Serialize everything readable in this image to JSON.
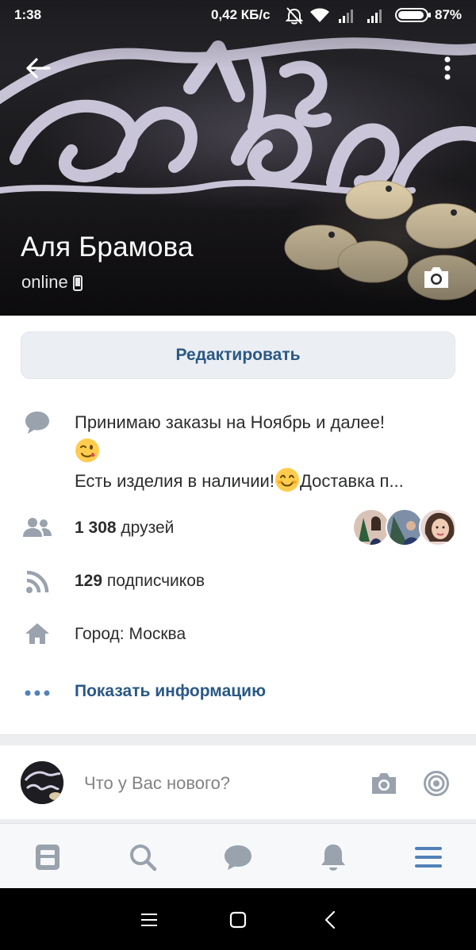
{
  "status_bar": {
    "time": "1:38",
    "network_speed": "0,42 КБ/с",
    "battery_percent": "87%",
    "icons": [
      "alarm-off-icon",
      "wifi-icon",
      "signal-icon",
      "signal-icon",
      "battery-icon"
    ]
  },
  "header": {
    "back_icon": "arrow-left-icon",
    "more_icon": "more-vertical-icon",
    "name": "Аля Брамова",
    "presence": "online",
    "presence_icon": "mobile-phone-icon",
    "cover_camera_icon": "camera-icon"
  },
  "edit_button": {
    "label": "Редактировать"
  },
  "status": {
    "icon": "speech-bubble-icon",
    "line1": "Принимаю заказы на Ноябрь и далее!",
    "line2_emoji": "winking-face-emoji",
    "line3_before_emoji": "Есть изделия в наличии!",
    "line3_emoji": "smiling-face-emoji",
    "line3_after_emoji": "Доставка п..."
  },
  "friends": {
    "icon": "people-icon",
    "count": "1 308",
    "label": "друзей",
    "avatars_count": 3
  },
  "followers": {
    "icon": "rss-icon",
    "count": "129",
    "label": "подписчиков"
  },
  "city": {
    "icon": "home-icon",
    "text": "Город: Москва"
  },
  "show_info": {
    "icon": "more-horizontal-icon",
    "label": "Показать информацию"
  },
  "composer": {
    "placeholder": "Что у Вас нового?",
    "camera_icon": "camera-icon",
    "live_icon": "live-broadcast-icon"
  },
  "tab_bar": {
    "tabs": [
      {
        "name": "news",
        "icon": "newsfeed-icon",
        "active": false
      },
      {
        "name": "search",
        "icon": "search-icon",
        "active": false
      },
      {
        "name": "messages",
        "icon": "message-bubble-icon",
        "active": false
      },
      {
        "name": "notifications",
        "icon": "bell-icon",
        "active": false
      },
      {
        "name": "menu",
        "icon": "hamburger-menu-icon",
        "active": true
      }
    ],
    "inactive_color": "#99a2ad",
    "active_color": "#5181b8"
  },
  "colors": {
    "link_blue": "#2a5885",
    "icon_gray": "#99a2ad",
    "accent_blue": "#5181b8",
    "separator": "#edeef0"
  }
}
